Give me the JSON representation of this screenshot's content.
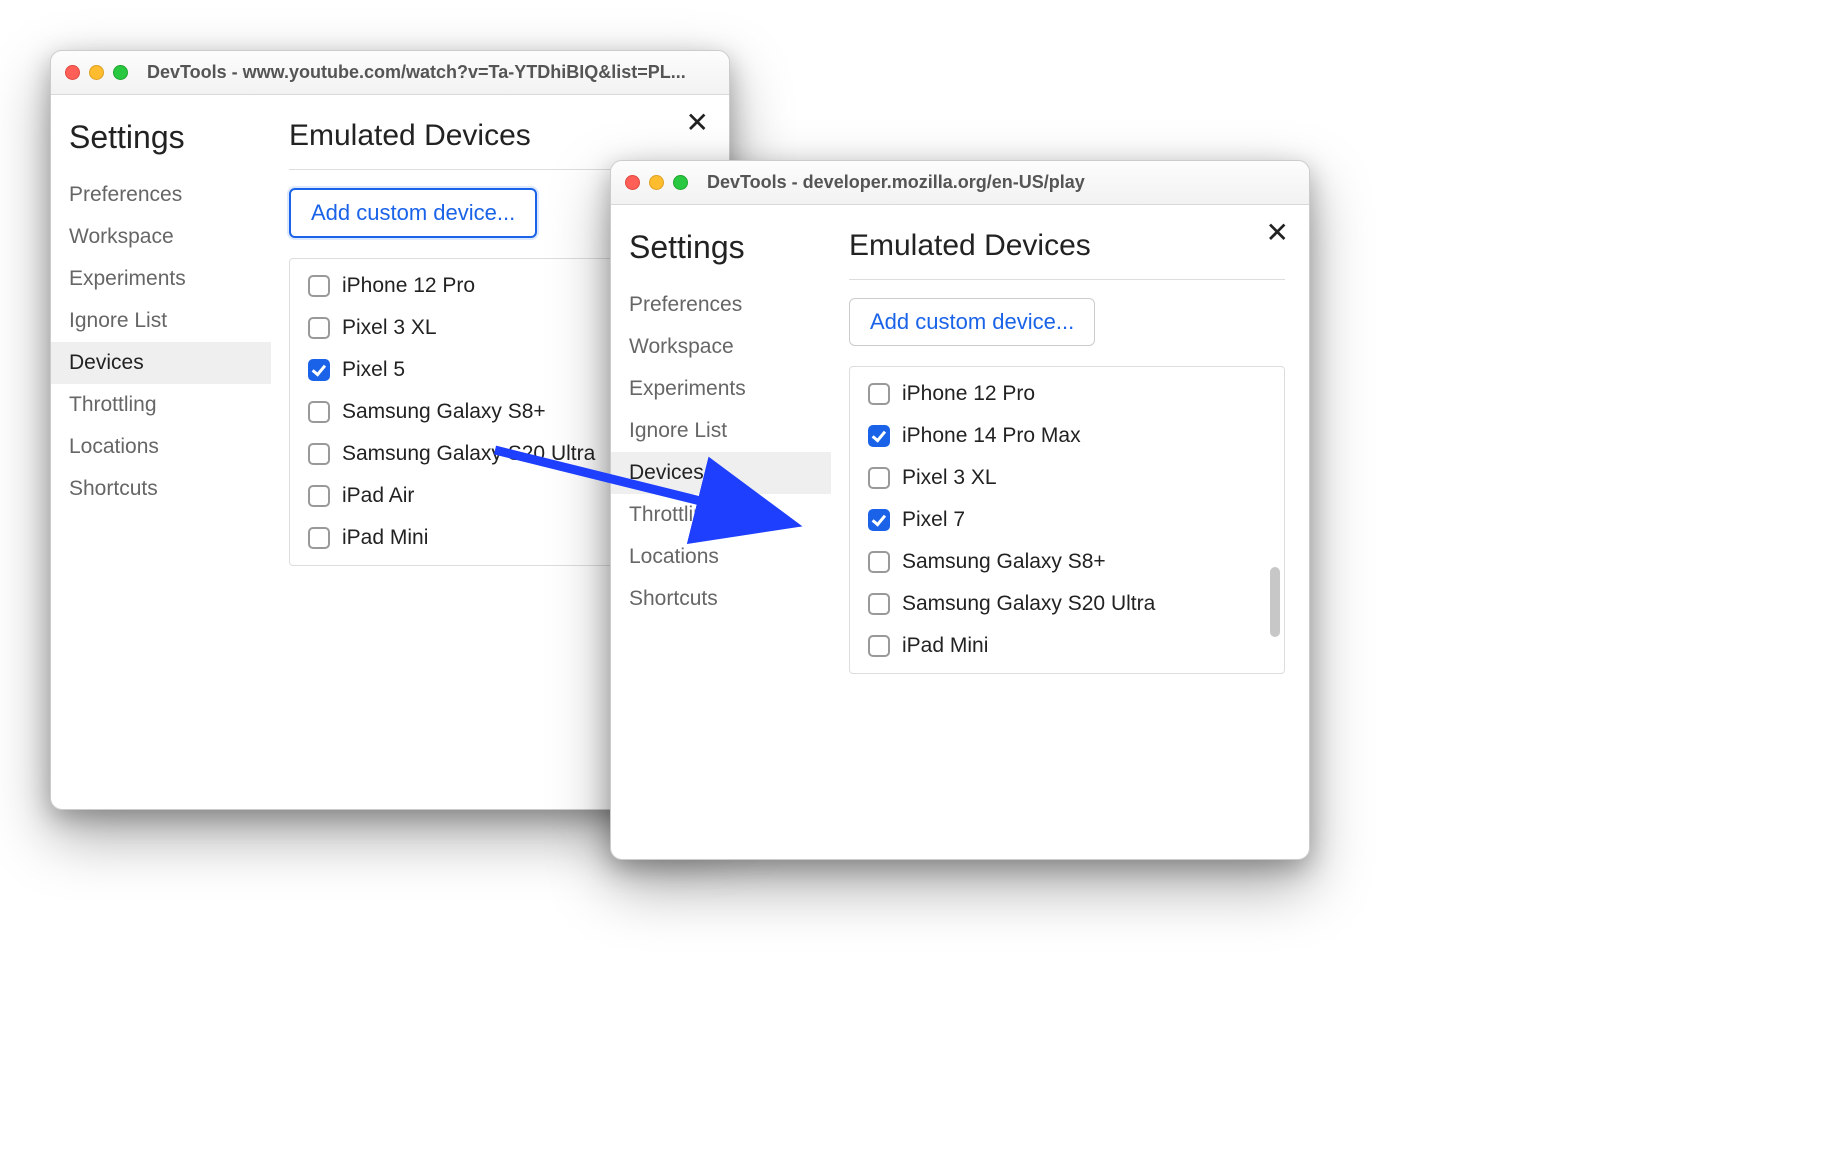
{
  "windowA": {
    "title": "DevTools - www.youtube.com/watch?v=Ta-YTDhiBIQ&list=PL...",
    "settingsHeading": "Settings",
    "mainHeading": "Emulated Devices",
    "addButton": "Add custom device...",
    "nav": [
      "Preferences",
      "Workspace",
      "Experiments",
      "Ignore List",
      "Devices",
      "Throttling",
      "Locations",
      "Shortcuts"
    ],
    "activeNav": "Devices",
    "devices": [
      {
        "label": "iPhone 12 Pro",
        "checked": false
      },
      {
        "label": "Pixel 3 XL",
        "checked": false
      },
      {
        "label": "Pixel 5",
        "checked": true
      },
      {
        "label": "Samsung Galaxy S8+",
        "checked": false
      },
      {
        "label": "Samsung Galaxy S20 Ultra",
        "checked": false
      },
      {
        "label": "iPad Air",
        "checked": false
      },
      {
        "label": "iPad Mini",
        "checked": false
      }
    ]
  },
  "windowB": {
    "title": "DevTools - developer.mozilla.org/en-US/play",
    "settingsHeading": "Settings",
    "mainHeading": "Emulated Devices",
    "addButton": "Add custom device...",
    "nav": [
      "Preferences",
      "Workspace",
      "Experiments",
      "Ignore List",
      "Devices",
      "Throttling",
      "Locations",
      "Shortcuts"
    ],
    "activeNav": "Devices",
    "devices": [
      {
        "label": "iPhone 12 Pro",
        "checked": false
      },
      {
        "label": "iPhone 14 Pro Max",
        "checked": true
      },
      {
        "label": "Pixel 3 XL",
        "checked": false
      },
      {
        "label": "Pixel 7",
        "checked": true
      },
      {
        "label": "Samsung Galaxy S8+",
        "checked": false
      },
      {
        "label": "Samsung Galaxy S20 Ultra",
        "checked": false
      },
      {
        "label": "iPad Mini",
        "checked": false
      }
    ]
  }
}
